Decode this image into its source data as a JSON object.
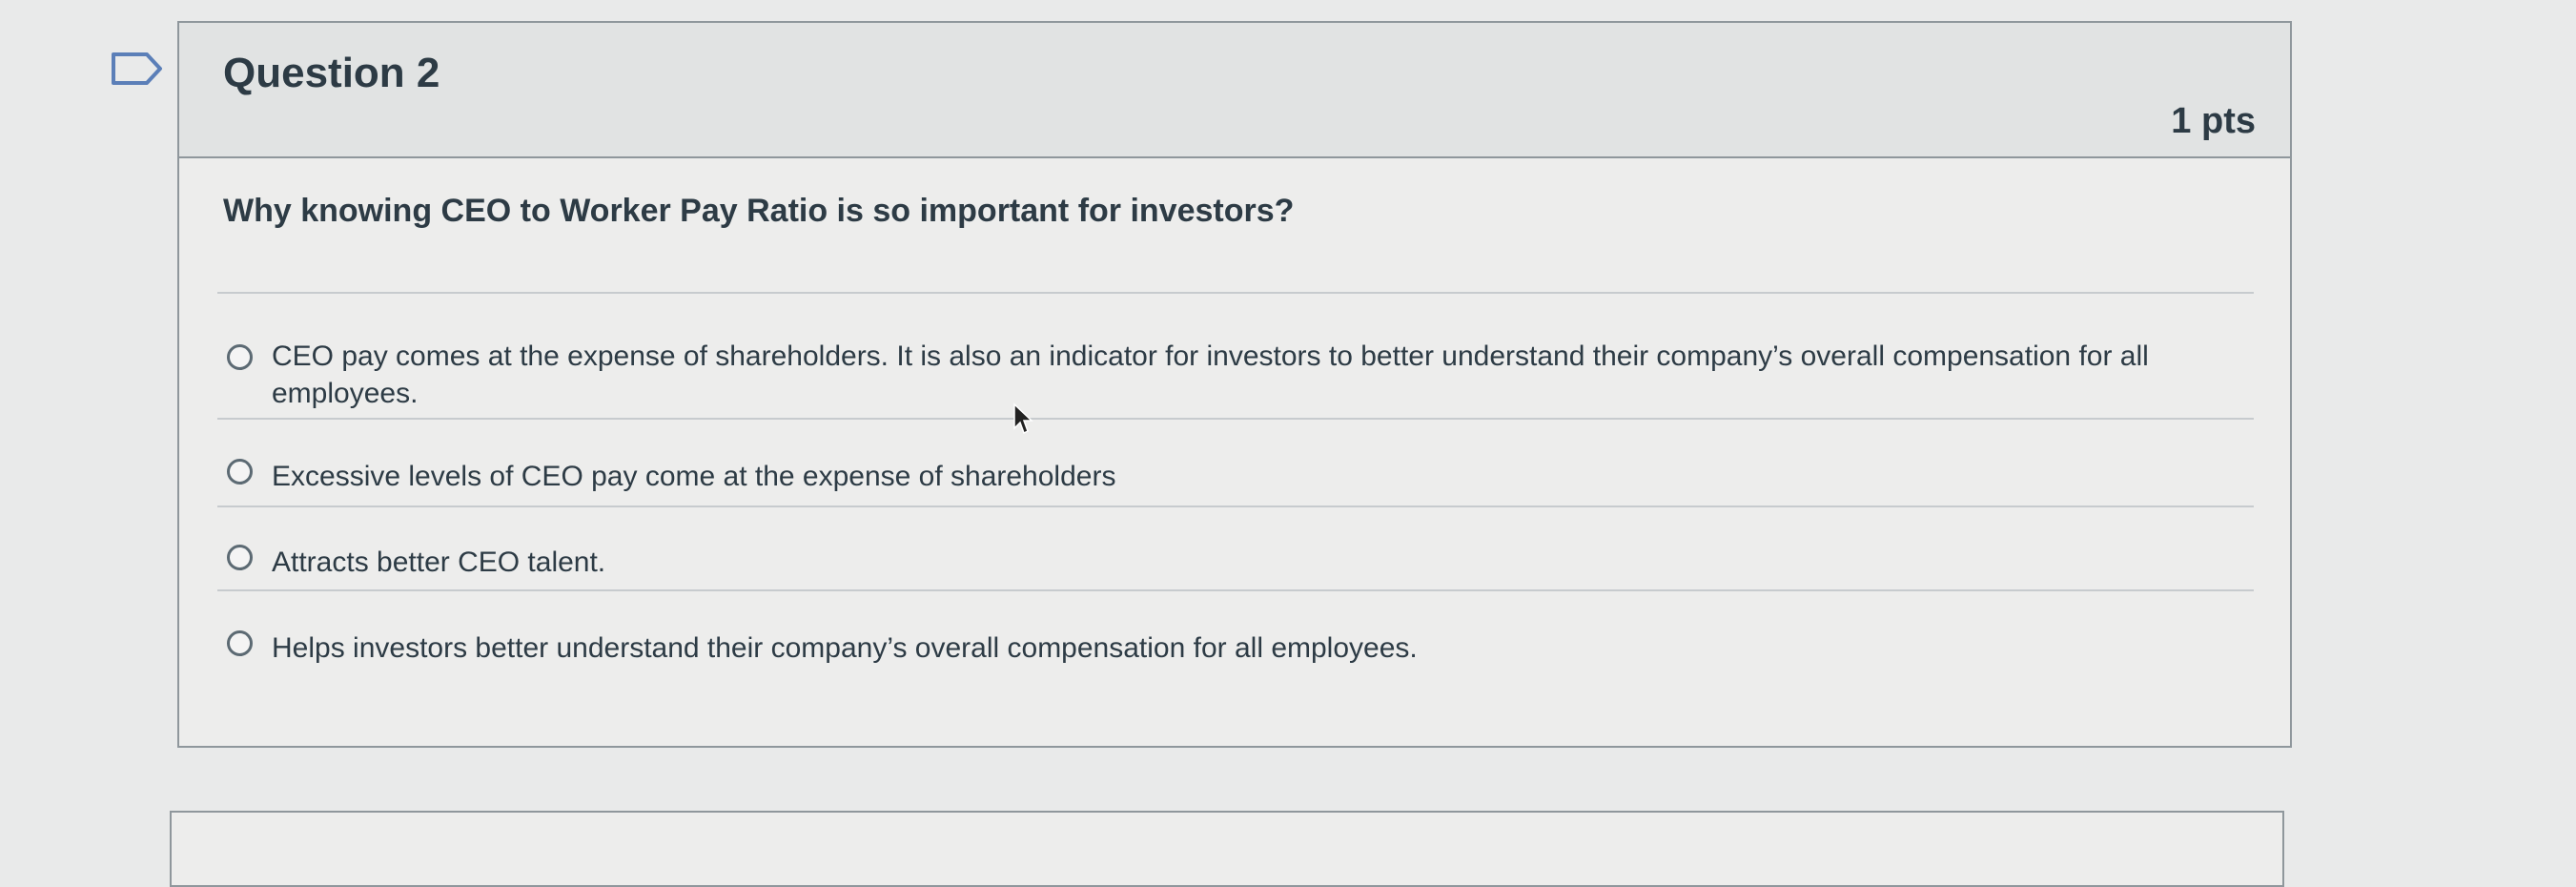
{
  "question": {
    "title": "Question 2",
    "points": "1 pts",
    "text": "Why knowing CEO to Worker Pay Ratio is so important for investors?"
  },
  "answers": [
    {
      "text": "CEO pay comes at the expense of shareholders. It is also an indicator for investors to better understand their company’s overall compensation for all employees.",
      "selected": false
    },
    {
      "text": "Excessive levels of CEO pay come at the expense of shareholders",
      "selected": false
    },
    {
      "text": "Attracts better CEO talent.",
      "selected": false
    },
    {
      "text": "Helps investors better understand their company’s overall compensation for all employees.",
      "selected": false
    }
  ],
  "icons": {
    "flag": "flag-outline-icon",
    "cursor": "mouse-pointer-icon",
    "radio": "radio-unchecked-icon"
  },
  "colors": {
    "page_background": "#e9eaea",
    "header_background": "#e1e3e3",
    "card_background": "#ededec",
    "text": "#2d3b45",
    "flag_outline": "#5b7fb8",
    "border": "#8f979c"
  }
}
